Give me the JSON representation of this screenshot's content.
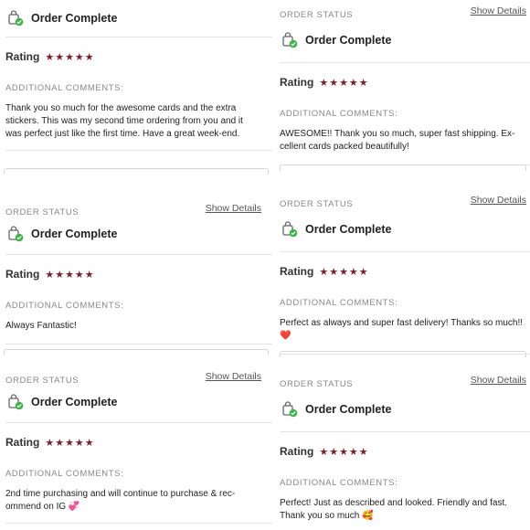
{
  "labels": {
    "order_status": "ORDER STATUS",
    "show_details": "Show Details",
    "order_complete": "Order Complete",
    "rating": "Rating",
    "stars": "★★★★★",
    "additional_comments": "ADDITIONAL COMMENTS:"
  },
  "colors": {
    "star": "#7a1f2b",
    "check": "#3bb54a"
  },
  "icons": {
    "order": "shopping-bag-check-icon"
  },
  "reviews_left": [
    {
      "comment": "Thank you so much for the awesome cards and the extra stickers. This was my second time ordering from you and it was perfect just like the first time. Have a great week-end."
    },
    {
      "comment": "Always Fantastic!"
    },
    {
      "comment": "2nd time purchasing and will continue to purchase & rec-ommend on IG 💞"
    }
  ],
  "reviews_right": [
    {
      "comment": "AWESOME!! Thank you so much, super fast shipping. Ex-cellent cards packed beautifully!"
    },
    {
      "comment": "Perfect as always and super fast delivery! Thanks so much!! ❤️"
    },
    {
      "comment": "Perfect! Just as described and looked. Friendly and fast. Thank you so much 🥰"
    }
  ]
}
